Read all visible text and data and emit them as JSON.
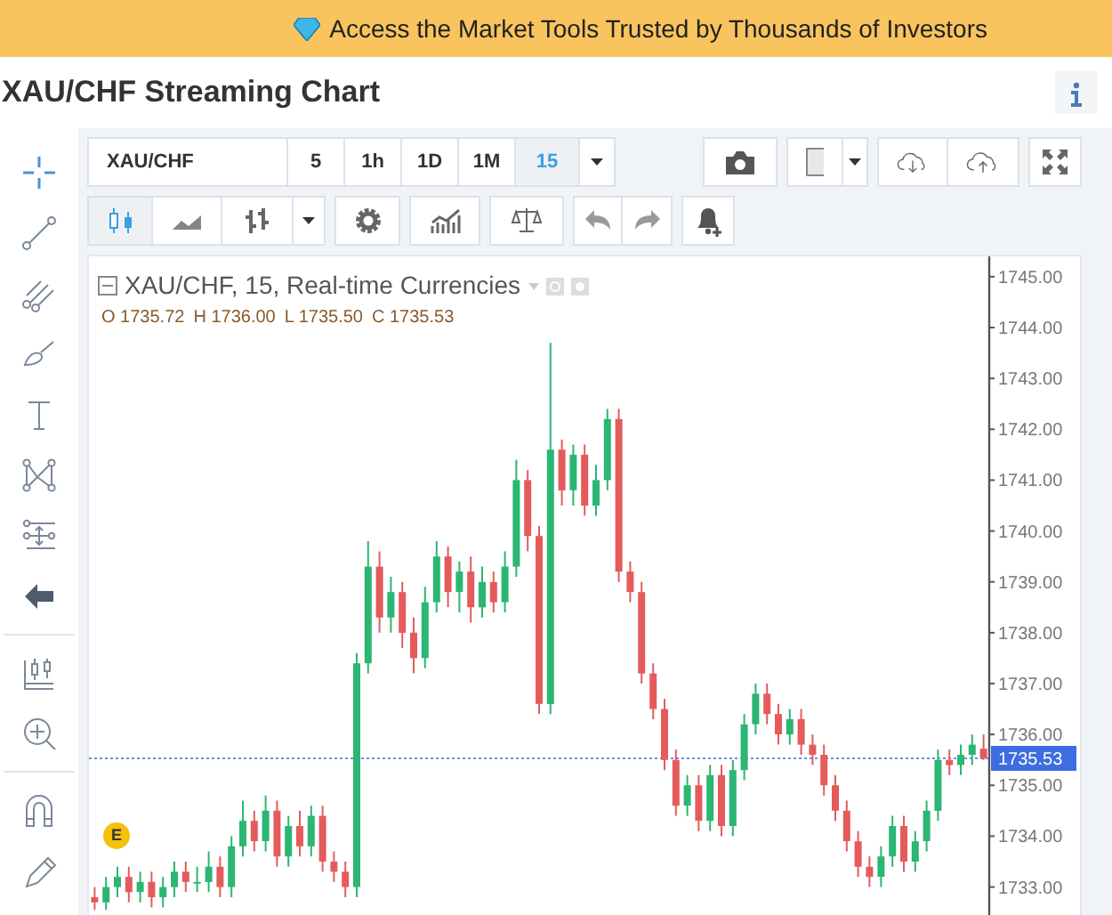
{
  "banner": {
    "text": "Access the Market Tools Trusted by Thousands of Investors"
  },
  "page_title": "XAU/CHF Streaming Chart",
  "symbol": "XAU/CHF",
  "intervals": [
    {
      "label": "5",
      "selected": false
    },
    {
      "label": "1h",
      "selected": false
    },
    {
      "label": "1D",
      "selected": false
    },
    {
      "label": "1M",
      "selected": false
    },
    {
      "label": "15",
      "selected": true
    }
  ],
  "chart_types": [
    {
      "kind": "candles",
      "selected": true
    },
    {
      "kind": "area",
      "selected": false
    },
    {
      "kind": "bars",
      "selected": false
    }
  ],
  "legend": {
    "title": "XAU/CHF, 15, Real-time Currencies",
    "ohlc": [
      "O 1735.72",
      "H 1736.00",
      "L 1735.50",
      "C 1735.53"
    ]
  },
  "chart": {
    "chart_data": {
      "type": "candlestick",
      "ylim": [
        1732.45,
        1745.4
      ],
      "ref_lines": [
        {
          "axis": "y",
          "value": 1735.53,
          "label": "1735.53"
        }
      ],
      "categories": [
        null,
        null,
        null,
        null,
        null,
        null,
        null,
        null,
        null,
        null,
        null,
        null,
        null,
        null,
        null,
        null,
        null,
        null,
        null,
        null,
        null,
        null,
        null,
        null,
        null,
        null,
        null,
        null,
        null,
        null,
        null,
        null,
        null,
        null,
        null,
        null,
        null,
        null,
        null,
        null,
        null,
        null,
        null,
        null,
        null,
        null,
        null,
        null,
        null,
        null,
        null,
        null,
        null,
        null,
        null,
        null,
        null,
        null,
        null,
        null,
        null,
        null,
        null,
        null,
        null,
        null,
        null,
        null,
        null,
        null,
        null,
        null,
        null,
        null,
        null,
        null,
        null,
        null,
        null
      ],
      "ohlc": [
        [
          1732.8,
          1733.0,
          1732.55,
          1732.7
        ],
        [
          1732.7,
          1733.2,
          1732.55,
          1733.0
        ],
        [
          1733.0,
          1733.4,
          1732.8,
          1733.2
        ],
        [
          1733.2,
          1733.4,
          1732.7,
          1732.9
        ],
        [
          1732.9,
          1733.3,
          1732.7,
          1733.1
        ],
        [
          1733.1,
          1733.3,
          1732.6,
          1732.8
        ],
        [
          1732.8,
          1733.2,
          1732.6,
          1733.0
        ],
        [
          1733.0,
          1733.5,
          1732.8,
          1733.3
        ],
        [
          1733.3,
          1733.5,
          1732.9,
          1733.1
        ],
        [
          1733.1,
          1733.4,
          1732.9,
          1733.1
        ],
        [
          1733.1,
          1733.7,
          1732.9,
          1733.4
        ],
        [
          1733.4,
          1733.6,
          1732.8,
          1733.0
        ],
        [
          1733.0,
          1734.0,
          1732.8,
          1733.8
        ],
        [
          1733.8,
          1734.7,
          1733.6,
          1734.3
        ],
        [
          1734.3,
          1734.5,
          1733.7,
          1733.9
        ],
        [
          1733.9,
          1734.8,
          1733.7,
          1734.5
        ],
        [
          1734.5,
          1734.7,
          1733.4,
          1733.6
        ],
        [
          1733.6,
          1734.4,
          1733.4,
          1734.2
        ],
        [
          1734.2,
          1734.5,
          1733.6,
          1733.8
        ],
        [
          1733.8,
          1734.6,
          1733.6,
          1734.4
        ],
        [
          1734.4,
          1734.6,
          1733.3,
          1733.5
        ],
        [
          1733.5,
          1733.7,
          1733.1,
          1733.3
        ],
        [
          1733.3,
          1733.5,
          1732.8,
          1733.0
        ],
        [
          1733.0,
          1737.6,
          1732.8,
          1737.4
        ],
        [
          1737.4,
          1739.8,
          1737.2,
          1739.3
        ],
        [
          1739.3,
          1739.6,
          1738.0,
          1738.3
        ],
        [
          1738.3,
          1739.1,
          1738.0,
          1738.8
        ],
        [
          1738.8,
          1739.0,
          1737.7,
          1738.0
        ],
        [
          1738.0,
          1738.3,
          1737.2,
          1737.5
        ],
        [
          1737.5,
          1738.9,
          1737.3,
          1738.6
        ],
        [
          1738.6,
          1739.8,
          1738.4,
          1739.5
        ],
        [
          1739.5,
          1739.7,
          1738.5,
          1738.8
        ],
        [
          1738.8,
          1739.4,
          1738.4,
          1739.2
        ],
        [
          1739.2,
          1739.5,
          1738.2,
          1738.5
        ],
        [
          1738.5,
          1739.3,
          1738.3,
          1739.0
        ],
        [
          1739.0,
          1739.2,
          1738.4,
          1738.6
        ],
        [
          1738.6,
          1739.6,
          1738.4,
          1739.3
        ],
        [
          1739.3,
          1741.4,
          1739.1,
          1741.0
        ],
        [
          1741.0,
          1741.2,
          1739.6,
          1739.9
        ],
        [
          1739.9,
          1740.1,
          1736.4,
          1736.6
        ],
        [
          1736.6,
          1743.7,
          1736.4,
          1741.6
        ],
        [
          1741.6,
          1741.8,
          1740.5,
          1740.8
        ],
        [
          1740.8,
          1741.7,
          1740.5,
          1741.5
        ],
        [
          1741.5,
          1741.7,
          1740.3,
          1740.5
        ],
        [
          1740.5,
          1741.3,
          1740.3,
          1741.0
        ],
        [
          1741.0,
          1742.4,
          1740.8,
          1742.2
        ],
        [
          1742.2,
          1742.4,
          1739.0,
          1739.2
        ],
        [
          1739.2,
          1739.4,
          1738.6,
          1738.8
        ],
        [
          1738.8,
          1739.0,
          1737.0,
          1737.2
        ],
        [
          1737.2,
          1737.4,
          1736.3,
          1736.5
        ],
        [
          1736.5,
          1736.7,
          1735.3,
          1735.5
        ],
        [
          1735.5,
          1735.7,
          1734.4,
          1734.6
        ],
        [
          1734.6,
          1735.2,
          1734.4,
          1735.0
        ],
        [
          1735.0,
          1735.2,
          1734.1,
          1734.3
        ],
        [
          1734.3,
          1735.4,
          1734.1,
          1735.2
        ],
        [
          1735.2,
          1735.4,
          1734.0,
          1734.2
        ],
        [
          1734.2,
          1735.5,
          1734.0,
          1735.3
        ],
        [
          1735.3,
          1736.4,
          1735.1,
          1736.2
        ],
        [
          1736.2,
          1737.0,
          1736.0,
          1736.8
        ],
        [
          1736.8,
          1737.0,
          1736.2,
          1736.4
        ],
        [
          1736.4,
          1736.6,
          1735.8,
          1736.0
        ],
        [
          1736.0,
          1736.5,
          1735.8,
          1736.3
        ],
        [
          1736.3,
          1736.5,
          1735.6,
          1735.8
        ],
        [
          1735.8,
          1736.0,
          1735.4,
          1735.6
        ],
        [
          1735.6,
          1735.8,
          1734.8,
          1735.0
        ],
        [
          1735.0,
          1735.2,
          1734.3,
          1734.5
        ],
        [
          1734.5,
          1734.7,
          1733.7,
          1733.9
        ],
        [
          1733.9,
          1734.1,
          1733.2,
          1733.4
        ],
        [
          1733.4,
          1733.6,
          1733.0,
          1733.2
        ],
        [
          1733.2,
          1733.8,
          1733.0,
          1733.6
        ],
        [
          1733.6,
          1734.4,
          1733.4,
          1734.2
        ],
        [
          1734.2,
          1734.4,
          1733.3,
          1733.5
        ],
        [
          1733.5,
          1734.1,
          1733.3,
          1733.9
        ],
        [
          1733.9,
          1734.7,
          1733.7,
          1734.5
        ],
        [
          1734.5,
          1735.7,
          1734.3,
          1735.5
        ],
        [
          1735.5,
          1735.7,
          1735.2,
          1735.4
        ],
        [
          1735.4,
          1735.8,
          1735.2,
          1735.6
        ],
        [
          1735.6,
          1736.0,
          1735.4,
          1735.8
        ],
        [
          1735.72,
          1736.0,
          1735.5,
          1735.53
        ]
      ],
      "yticks": [
        {
          "value": 1745,
          "label": "1745.00"
        },
        {
          "value": 1744,
          "label": "1744.00"
        },
        {
          "value": 1743,
          "label": "1743.00"
        },
        {
          "value": 1742,
          "label": "1742.00"
        },
        {
          "value": 1741,
          "label": "1741.00"
        },
        {
          "value": 1740,
          "label": "1740.00"
        },
        {
          "value": 1739,
          "label": "1739.00"
        },
        {
          "value": 1738,
          "label": "1738.00"
        },
        {
          "value": 1737,
          "label": "1737.00"
        },
        {
          "value": 1736,
          "label": "1736.00"
        },
        {
          "value": 1735,
          "label": "1735.00"
        },
        {
          "value": 1734,
          "label": "1734.00"
        },
        {
          "value": 1733,
          "label": "1733.00"
        }
      ]
    }
  },
  "event_marker": "E"
}
